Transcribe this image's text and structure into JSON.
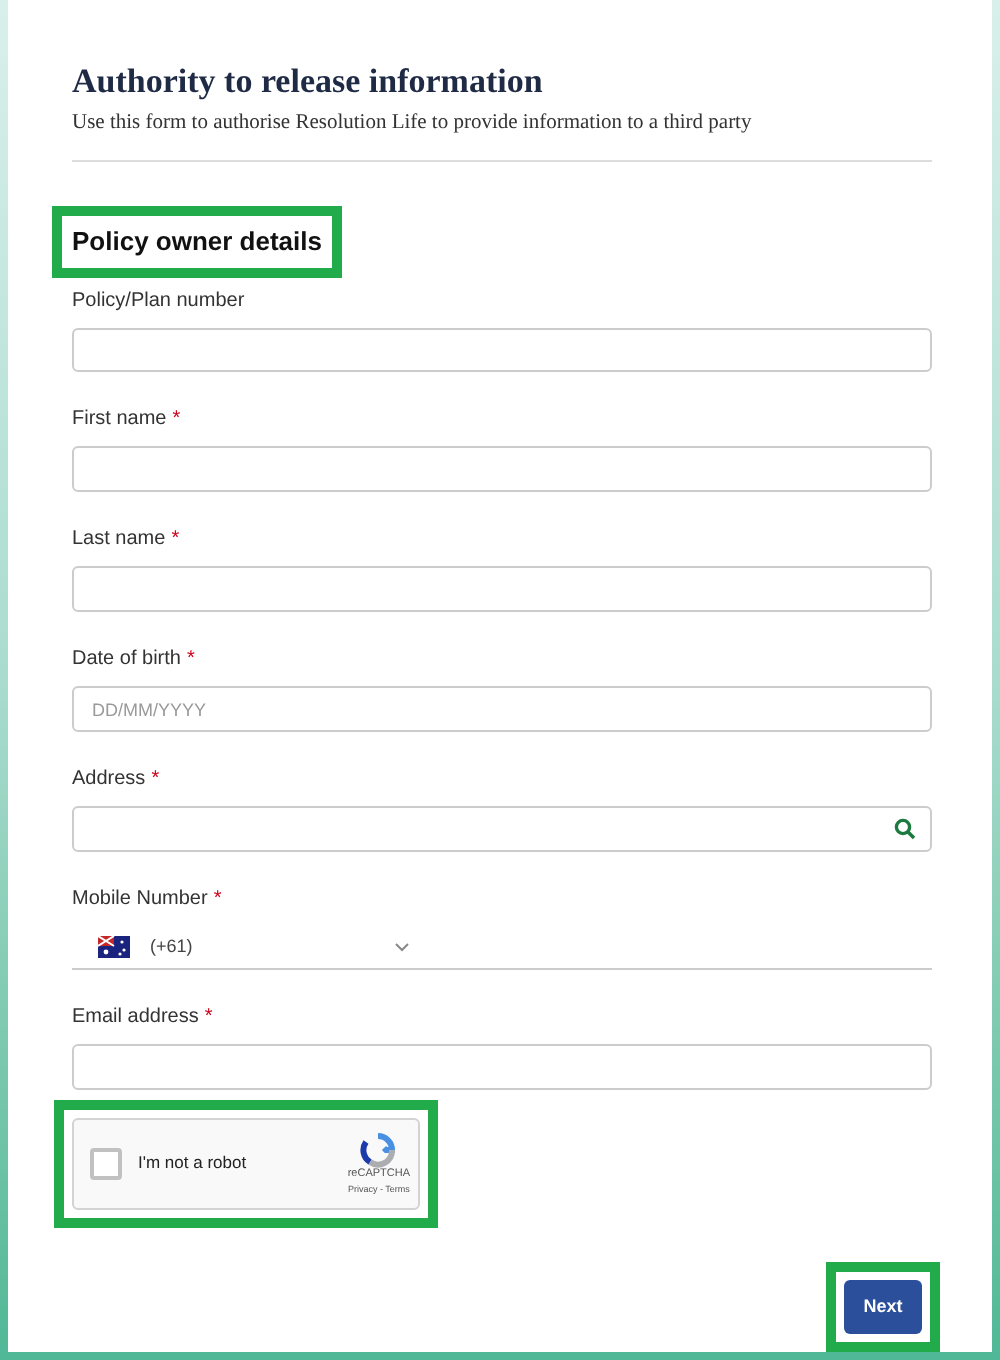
{
  "header": {
    "title": "Authority to release information",
    "subtitle": "Use this form to authorise Resolution Life to provide information to a third party"
  },
  "section": {
    "title": "Policy owner details",
    "highlighted": true
  },
  "fields": [
    {
      "kind": "text",
      "label": "Policy/Plan number",
      "required": false
    },
    {
      "kind": "text",
      "label": "First name",
      "required": true
    },
    {
      "kind": "text",
      "label": "Last name",
      "required": true
    },
    {
      "kind": "text",
      "label": "Date of birth",
      "required": true,
      "placeholder": "DD/MM/YYYY"
    },
    {
      "kind": "search",
      "label": "Address",
      "required": true
    },
    {
      "kind": "phone",
      "label": "Mobile Number",
      "required": true,
      "code": "(+61)"
    },
    {
      "kind": "text",
      "label": "Email address",
      "required": true
    }
  ],
  "required_mark": "*",
  "captcha": {
    "label": "I'm not a robot",
    "checked": false,
    "brand": "reCAPTCHA",
    "links": "Privacy - Terms",
    "highlighted": true
  },
  "next_button": {
    "label": "Next",
    "highlighted": true
  }
}
